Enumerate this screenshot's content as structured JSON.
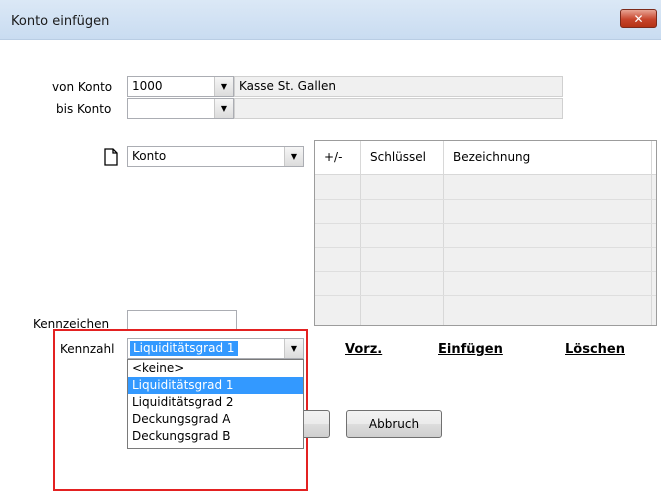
{
  "window": {
    "title": "Konto einfügen",
    "close_glyph": "✕"
  },
  "von_konto": {
    "label": "von Konto",
    "value": "1000",
    "description": "Kasse St. Gallen"
  },
  "bis_konto": {
    "label": "bis Konto",
    "value": "",
    "description": ""
  },
  "type_select": {
    "icon": "document-icon",
    "value": "Konto"
  },
  "grid": {
    "columns": [
      "+/-",
      "Schlüssel",
      "Bezeichnung"
    ]
  },
  "kennzeichen": {
    "label": "Kennzeichen",
    "value": ""
  },
  "kennzahl": {
    "label": "Kennzahl",
    "selected": "Liquiditätsgrad 1",
    "options": [
      "<keine>",
      "Liquiditätsgrad 1",
      "Liquiditätsgrad 2",
      "Deckungsgrad A",
      "Deckungsgrad B"
    ],
    "highlighted_index": 1
  },
  "actions": {
    "vorz": "Vorz.",
    "einfuegen": "Einfügen",
    "loeschen": "Löschen"
  },
  "buttons": {
    "abbruch": "Abbruch"
  },
  "colors": {
    "selection": "#3399ff",
    "highlight_border": "#e32121",
    "close_button": "#c7452c"
  }
}
